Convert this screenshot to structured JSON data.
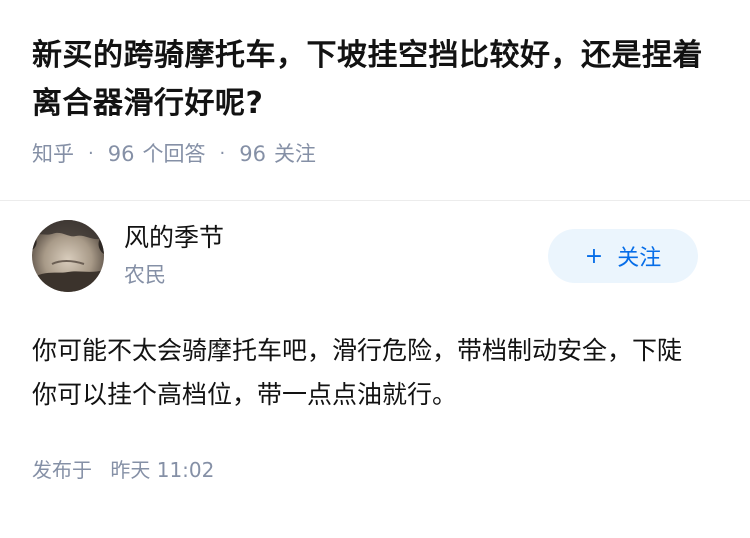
{
  "question": {
    "title": "新买的跨骑摩托车，下坡挂空挡比较好，还是捏着离合器滑行好呢?",
    "source": "知乎",
    "answer_count": "96",
    "answer_label": "个回答",
    "follower_count": "96",
    "follower_label": "关注",
    "separator": "·"
  },
  "answer": {
    "author_name": "风的季节",
    "author_badge": "农民",
    "follow_label": "关注",
    "follow_icon": "+",
    "content": "你可能不太会骑摩托车吧，滑行危险，带档制动安全，下陡你可以挂个高档位，带一点点油就行。",
    "time_label": "发布于",
    "time_value": "昨天 11:02"
  },
  "colors": {
    "text_primary": "#121212",
    "text_secondary": "#8590a6",
    "follow_bg": "#ebf5fd",
    "follow_text": "#056de8"
  }
}
